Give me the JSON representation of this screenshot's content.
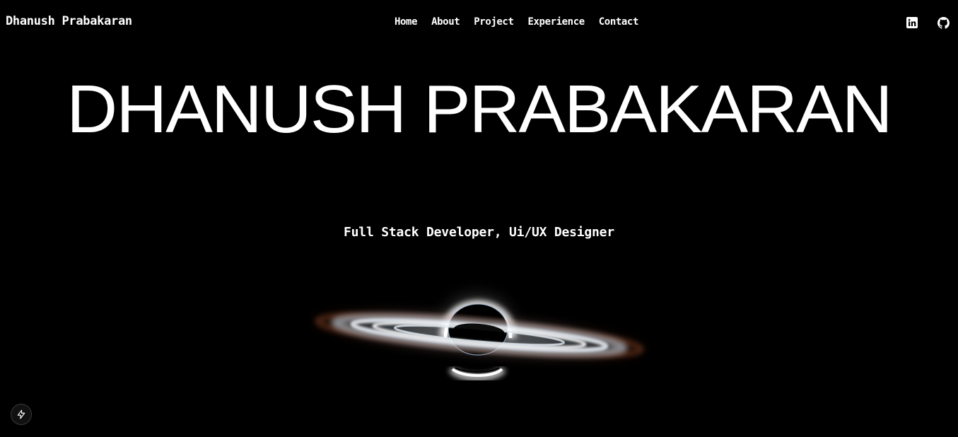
{
  "header": {
    "brand": "Dhanush Prabakaran",
    "nav": [
      {
        "label": "Home"
      },
      {
        "label": "About"
      },
      {
        "label": "Project"
      },
      {
        "label": "Experience"
      },
      {
        "label": "Contact"
      }
    ],
    "social": [
      {
        "icon": "linkedin-icon"
      },
      {
        "icon": "github-icon"
      }
    ]
  },
  "hero": {
    "title": "DHANUSH PRABAKARAN",
    "subtitle": "Full Stack Developer, Ui/UX Designer",
    "image": "black-hole-graphic"
  },
  "dev_badge": {
    "icon": "lightning-bolt-icon"
  },
  "colors": {
    "background": "#000000",
    "text": "#ffffff",
    "accent_glow": "#dfe8f2",
    "dust_orange": "#a4502a"
  }
}
